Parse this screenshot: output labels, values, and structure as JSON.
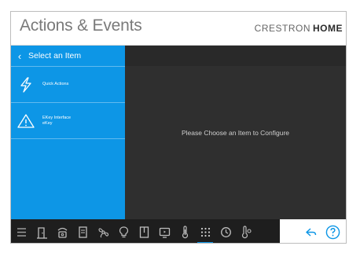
{
  "header": {
    "title": "Actions & Events",
    "brand_light": "CRESTRON",
    "brand_bold": "HOME"
  },
  "sidebar": {
    "header_label": "Select an Item",
    "items": [
      {
        "label": "Quick Actions",
        "icon": "lightning-icon"
      },
      {
        "label": "EKey Interface\neKey",
        "icon": "warning-triangle-icon"
      }
    ]
  },
  "main": {
    "placeholder": "Please Choose an Item to Configure"
  },
  "toolbar": {
    "icons": [
      "menu-icon",
      "door-icon",
      "phone-icon",
      "door-panel-icon",
      "fan-icon",
      "bulb-icon",
      "shade-icon",
      "display-icon",
      "thermometer-icon",
      "keypad-icon",
      "clock-icon",
      "sensor-icon"
    ],
    "active_index": 9,
    "right_icons": [
      "back-arrow-icon",
      "help-icon"
    ]
  },
  "colors": {
    "accent": "#0d96e6",
    "toolbar_bg": "#1e1e1e",
    "main_bg": "#2f2f2f"
  }
}
